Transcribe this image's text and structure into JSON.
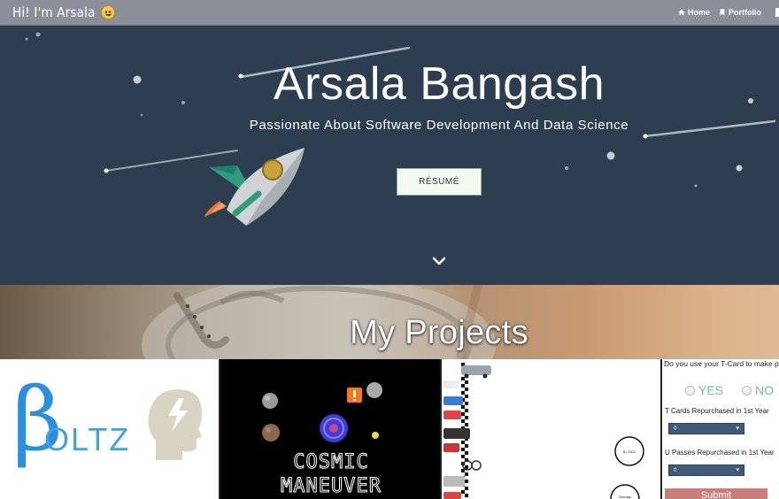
{
  "navbar": {
    "brand": "Hi! I'm Arsala",
    "links": [
      {
        "label": "Home",
        "icon": "home-icon"
      },
      {
        "label": "Portfolio",
        "icon": "bookmark-icon"
      }
    ]
  },
  "hero": {
    "title": "Arsala Bangash",
    "subtitle": "Passionate About Software Development And Data Science",
    "resume_button": "RÉSUMÉ",
    "scroll_icon": "chevron-down-icon",
    "background_color": "#2c3e50"
  },
  "projects": {
    "title": "My Projects",
    "tiles": [
      {
        "name": "boltz",
        "logo_letter": "β",
        "logo_text": "OLTZ"
      },
      {
        "name": "cosmic-maneuver",
        "line1": "COSMIC",
        "line2": "MANEUVER"
      },
      {
        "name": "traffic-simulation",
        "clock_label_1": "8 / 2011",
        "clock_label_2": "Sunday"
      },
      {
        "name": "tcard-survey",
        "question": "Do you use your T-Card to make pur",
        "yes": "YES",
        "no": "NO",
        "label1": "T Cards Repurchased in 1st Year",
        "select1": "0",
        "label2": "U Passes Repurchased in 1st Year",
        "select2": "0",
        "submit": "Submit"
      }
    ]
  }
}
